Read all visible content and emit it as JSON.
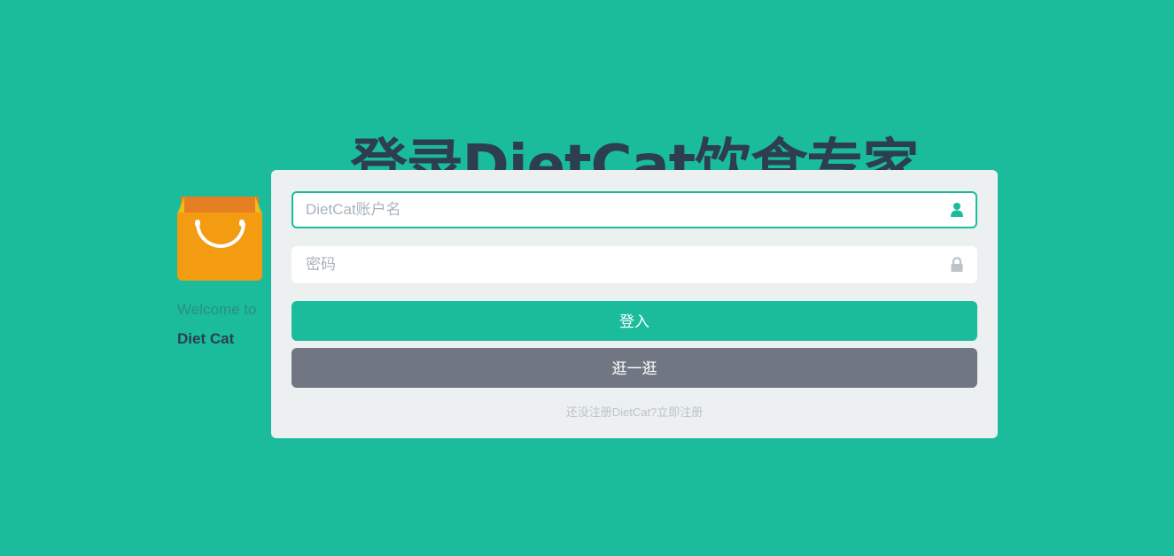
{
  "page": {
    "title": "登录DietCat饮食专家"
  },
  "brand": {
    "logo_icon": "shopping-bag-icon",
    "welcome_text": "Welcome to",
    "name": "Diet Cat"
  },
  "form": {
    "username": {
      "placeholder": "DietCat账户名",
      "value": "",
      "icon": "user-icon",
      "focused": true
    },
    "password": {
      "placeholder": "密码",
      "value": "",
      "icon": "lock-icon"
    },
    "login_button_label": "登入",
    "browse_button_label": "逛一逛",
    "register_link_text": "还没注册DietCat?立即注册"
  },
  "colors": {
    "background": "#1abc9c",
    "panel": "#ecf0f1",
    "title": "#2c3e50",
    "primary_button": "#1abc9c",
    "secondary_button": "#707783",
    "bag_body": "#f39c12",
    "bag_top": "#e67e22"
  }
}
